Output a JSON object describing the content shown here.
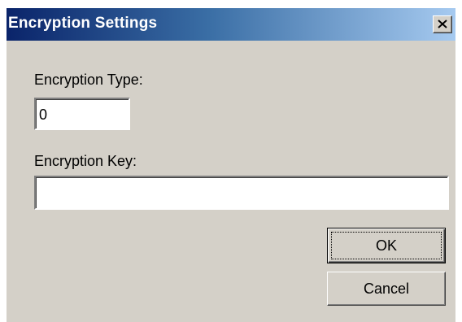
{
  "dialog": {
    "title": "Encryption Settings",
    "close_symbol": "close-icon"
  },
  "form": {
    "type_label": "Encryption Type:",
    "type_value": "0",
    "key_label": "Encryption Key:",
    "key_value": ""
  },
  "buttons": {
    "ok_label": "OK",
    "cancel_label": "Cancel"
  },
  "colors": {
    "titlebar_start": "#0a246a",
    "titlebar_end": "#a6caf0",
    "face": "#d4d0c8"
  }
}
